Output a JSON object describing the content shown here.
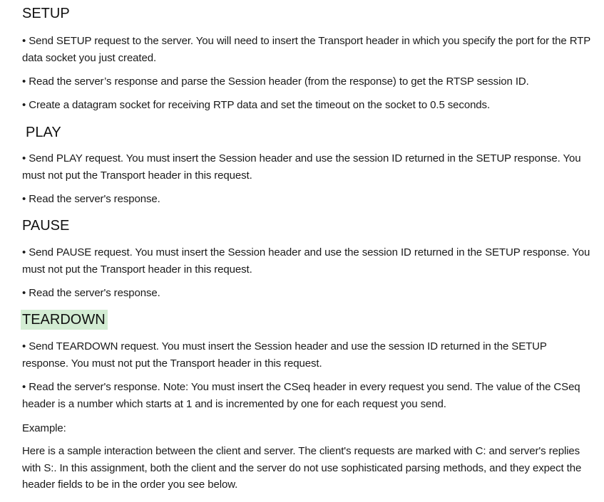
{
  "sections": [
    {
      "heading": "SETUP",
      "bullets": [
        "Send SETUP request to the server. You will need to insert the Transport header in which you specify the port for the RTP data socket you just created.",
        "Read the server’s response and parse the Session header (from the response) to get the RTSP session ID.",
        "Create a datagram socket for receiving RTP data and set the timeout on the socket to 0.5 seconds."
      ]
    },
    {
      "heading": "PLAY",
      "bullets": [
        "Send PLAY request. You must insert the Session header and use the session ID returned in the SETUP response. You must not put the Transport header in this request.",
        "Read the server's response."
      ]
    },
    {
      "heading": "PAUSE",
      "bullets": [
        "Send PAUSE request. You must insert the Session header and use the session ID returned in the SETUP response. You must not put the Transport header in this request.",
        "Read the server's response."
      ]
    },
    {
      "heading": "TEARDOWN",
      "heading_highlight": "#d3ecd3",
      "bullets": [
        "Send TEARDOWN request. You must insert the Session header and use the session ID returned in the SETUP response. You must not put the Transport header in this request.",
        "Read the server's response. Note: You must insert the CSeq header in every request you send. The value of the CSeq header is a number which starts at 1 and is incremented by one for each request you send."
      ]
    }
  ],
  "bullet_glyph": "•",
  "example_label": "Example:",
  "closing_paragraph": "Here is a sample interaction between the client and server. The client's requests are marked with C: and server's replies with S:. In this assignment, both the client and the server do not use sophisticated parsing methods, and they expect the header fields to be in the order you see below."
}
